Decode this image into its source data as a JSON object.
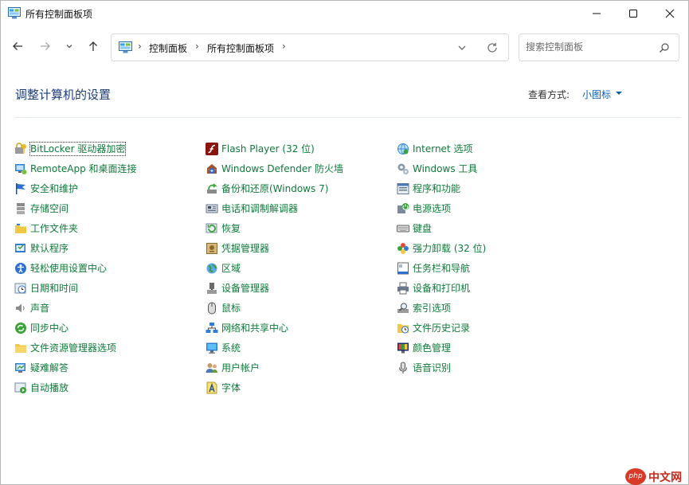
{
  "window": {
    "title": "所有控制面板项"
  },
  "nav": {
    "breadcrumbs": [
      "控制面板",
      "所有控制面板项"
    ],
    "search_placeholder": "搜索控制面板"
  },
  "header": {
    "title": "调整计算机的设置",
    "view_label": "查看方式:",
    "view_value": "小图标"
  },
  "columns": [
    [
      {
        "label": "BitLocker 驱动器加密",
        "icon": "bitlocker-icon"
      },
      {
        "label": "RemoteApp 和桌面连接",
        "icon": "remoteapp-icon"
      },
      {
        "label": "安全和维护",
        "icon": "flag-icon"
      },
      {
        "label": "存储空间",
        "icon": "storage-icon"
      },
      {
        "label": "工作文件夹",
        "icon": "work-folders-icon"
      },
      {
        "label": "默认程序",
        "icon": "default-programs-icon"
      },
      {
        "label": "轻松使用设置中心",
        "icon": "ease-of-access-icon"
      },
      {
        "label": "日期和时间",
        "icon": "clock-icon"
      },
      {
        "label": "声音",
        "icon": "speaker-icon"
      },
      {
        "label": "同步中心",
        "icon": "sync-icon"
      },
      {
        "label": "文件资源管理器选项",
        "icon": "folder-options-icon"
      },
      {
        "label": "疑难解答",
        "icon": "troubleshoot-icon"
      },
      {
        "label": "自动播放",
        "icon": "autoplay-icon"
      }
    ],
    [
      {
        "label": "Flash Player (32 位)",
        "icon": "flash-icon"
      },
      {
        "label": "Windows Defender 防火墙",
        "icon": "firewall-icon"
      },
      {
        "label": "备份和还原(Windows 7)",
        "icon": "backup-icon"
      },
      {
        "label": "电话和调制解调器",
        "icon": "phone-modem-icon"
      },
      {
        "label": "恢复",
        "icon": "recovery-icon"
      },
      {
        "label": "凭据管理器",
        "icon": "credential-icon"
      },
      {
        "label": "区域",
        "icon": "region-icon"
      },
      {
        "label": "设备管理器",
        "icon": "device-manager-icon"
      },
      {
        "label": "鼠标",
        "icon": "mouse-icon"
      },
      {
        "label": "网络和共享中心",
        "icon": "network-icon"
      },
      {
        "label": "系统",
        "icon": "system-icon"
      },
      {
        "label": "用户帐户",
        "icon": "user-accounts-icon"
      },
      {
        "label": "字体",
        "icon": "fonts-icon"
      }
    ],
    [
      {
        "label": "Internet 选项",
        "icon": "internet-options-icon"
      },
      {
        "label": "Windows 工具",
        "icon": "windows-tools-icon"
      },
      {
        "label": "程序和功能",
        "icon": "programs-features-icon"
      },
      {
        "label": "电源选项",
        "icon": "power-icon"
      },
      {
        "label": "键盘",
        "icon": "keyboard-icon"
      },
      {
        "label": "强力卸载 (32 位)",
        "icon": "uninstaller-icon"
      },
      {
        "label": "任务栏和导航",
        "icon": "taskbar-icon"
      },
      {
        "label": "设备和打印机",
        "icon": "printer-icon"
      },
      {
        "label": "索引选项",
        "icon": "indexing-icon"
      },
      {
        "label": "文件历史记录",
        "icon": "file-history-icon"
      },
      {
        "label": "颜色管理",
        "icon": "color-management-icon"
      },
      {
        "label": "语音识别",
        "icon": "microphone-icon"
      }
    ]
  ],
  "watermark": {
    "badge": "php",
    "text": "中文网"
  }
}
